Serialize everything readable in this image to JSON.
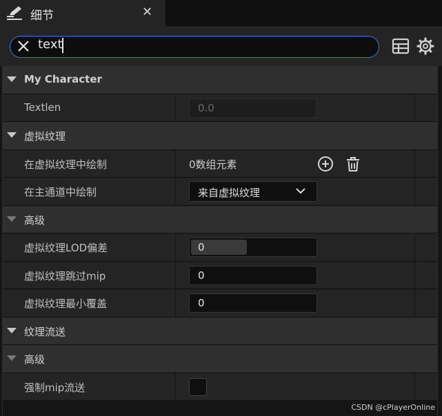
{
  "tab": {
    "title": "细节",
    "close": "✕"
  },
  "search": {
    "value": "text"
  },
  "rows": [
    {
      "kind": "category",
      "label": "My Character"
    },
    {
      "kind": "property",
      "label": "Textlen",
      "value": "0.0"
    },
    {
      "kind": "category",
      "label": "虚拟纹理"
    },
    {
      "kind": "property",
      "label": "在虚拟纹理中绘制",
      "value": "0数组元素"
    },
    {
      "kind": "property",
      "label": "在主通道中绘制",
      "value": "来自虚拟纹理"
    },
    {
      "kind": "category",
      "label": "高级"
    },
    {
      "kind": "property",
      "label": "虚拟纹理LOD偏差",
      "value": "0",
      "slider_fill": 0.45
    },
    {
      "kind": "property",
      "label": "虚拟纹理跳过mip",
      "value": "0"
    },
    {
      "kind": "property",
      "label": "虚拟纹理最小覆盖",
      "value": "0"
    },
    {
      "kind": "category",
      "label": "纹理流送"
    },
    {
      "kind": "category",
      "label": "高级"
    },
    {
      "kind": "property",
      "label": "强制mip流送",
      "checked": false
    }
  ],
  "watermark": "CSDN @cPlayerOnline",
  "colors": {
    "accent": "#2a7fd8",
    "panel": "#242424",
    "category": "#2f2f2f"
  }
}
